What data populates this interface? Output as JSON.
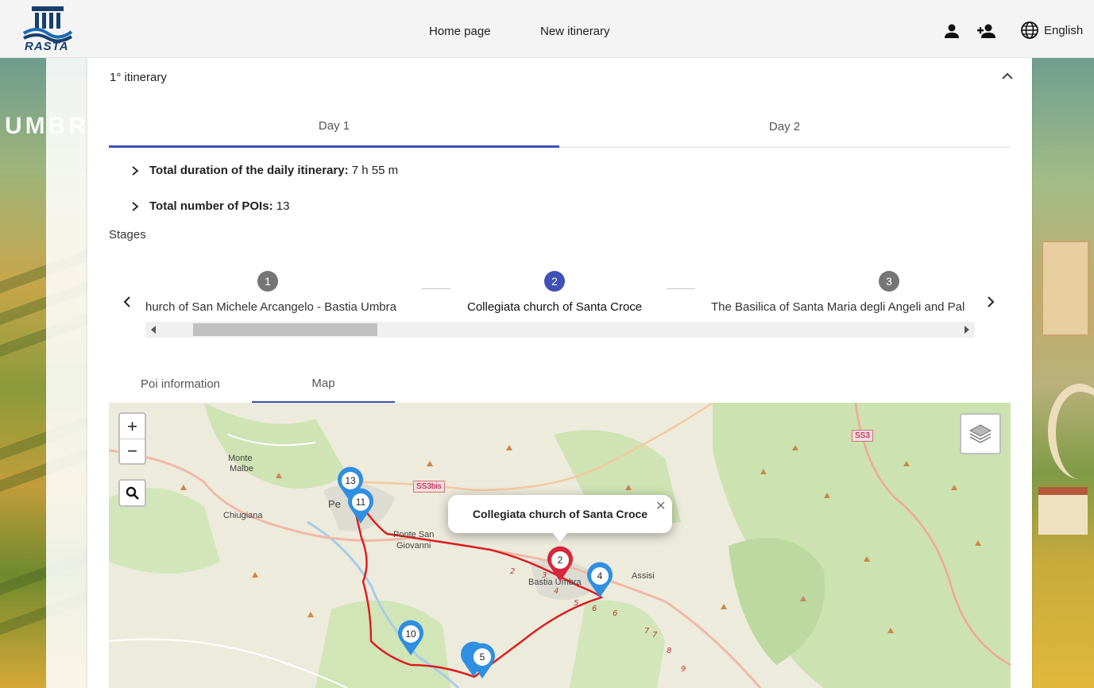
{
  "header": {
    "logo_text": "RASTA",
    "nav": [
      "Home page",
      "New itinerary"
    ],
    "language": "English"
  },
  "background": {
    "left_text": "UMBR"
  },
  "itinerary": {
    "title": "1° itinerary",
    "days": [
      "Day 1",
      "Day 2"
    ],
    "active_day": 0,
    "duration_label": "Total duration of the daily itinerary:",
    "duration_value": "7 h 55 m",
    "pois_label": "Total number of POIs:",
    "pois_value": "13",
    "stages_label": "Stages"
  },
  "stages": [
    {
      "number": "1",
      "label": "hurch of San Michele Arcangelo - Bastia Umbra",
      "active": false
    },
    {
      "number": "2",
      "label": "Collegiata church of Santa Croce",
      "active": true
    },
    {
      "number": "3",
      "label": "The Basilica of Santa Maria degli Angeli and Pal",
      "active": false
    }
  ],
  "sub_tabs": [
    "Poi information",
    "Map"
  ],
  "active_sub_tab": 1,
  "map": {
    "popup_title": "Collegiata church of Santa Croce",
    "markers": [
      "13",
      "11",
      "2",
      "4",
      "10",
      "5"
    ],
    "places": [
      "Monte",
      "Malbe",
      "Chiugiana",
      "Pe",
      "Ponte San",
      "Giovanni",
      "Bastia Umbra",
      "Assisi"
    ],
    "road_labels": [
      "SS3bis",
      "SS3"
    ],
    "route_km": [
      "2",
      "3",
      "4",
      "5",
      "6",
      "6",
      "7",
      "7",
      "8",
      "9"
    ]
  },
  "colors": {
    "accent": "#3f51b5",
    "marker_blue": "#2f8fe0",
    "marker_red": "#d7263d",
    "route": "#e0191c"
  }
}
